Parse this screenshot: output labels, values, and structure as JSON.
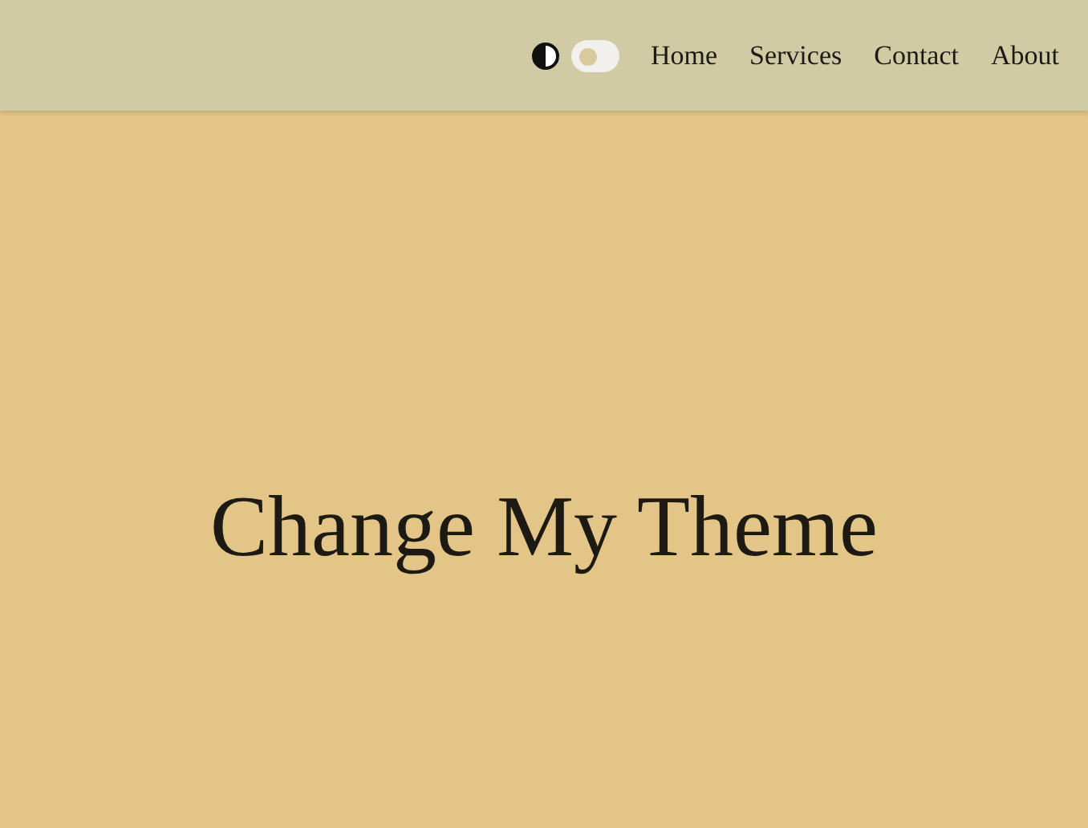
{
  "header": {
    "theme_toggle": {
      "on": false
    },
    "nav": [
      {
        "label": "Home"
      },
      {
        "label": "Services"
      },
      {
        "label": "Contact"
      },
      {
        "label": "About"
      }
    ]
  },
  "hero": {
    "title": "Change My Theme"
  }
}
